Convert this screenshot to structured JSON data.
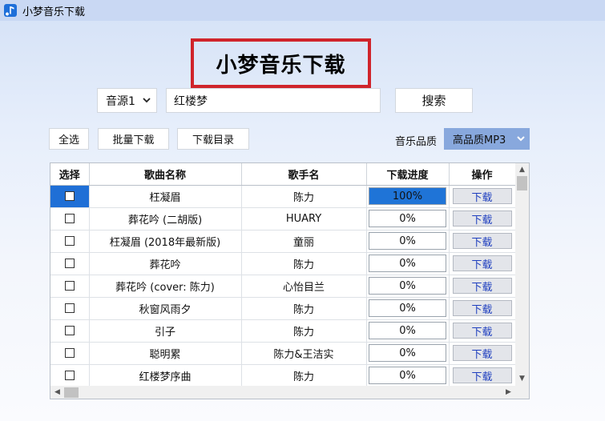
{
  "window": {
    "title": "小梦音乐下载",
    "icon": "music-note-icon"
  },
  "header": {
    "headline": "小梦音乐下载"
  },
  "search": {
    "source_selected": "音源1",
    "query": "红楼梦",
    "button_label": "搜索"
  },
  "toolbar": {
    "select_all_label": "全选",
    "batch_download_label": "批量下载",
    "download_dir_label": "下载目录",
    "quality_label": "音乐品质",
    "quality_selected": "高品质MP3"
  },
  "table": {
    "columns": [
      "选择",
      "歌曲名称",
      "歌手名",
      "下载进度",
      "操作"
    ],
    "rows": [
      {
        "song": "枉凝眉",
        "artist": "陈力",
        "progress": "100%",
        "progress_value": 1.0,
        "action": "下载"
      },
      {
        "song": "葬花吟 (二胡版)",
        "artist": "HUARY",
        "progress": "0%",
        "progress_value": 0,
        "action": "下载"
      },
      {
        "song": "枉凝眉 (2018年最新版)",
        "artist": "童丽",
        "progress": "0%",
        "progress_value": 0,
        "action": "下载"
      },
      {
        "song": "葬花吟",
        "artist": "陈力",
        "progress": "0%",
        "progress_value": 0,
        "action": "下载"
      },
      {
        "song": "葬花吟 (cover: 陈力)",
        "artist": "心怡目兰",
        "progress": "0%",
        "progress_value": 0,
        "action": "下载"
      },
      {
        "song": "秋窗风雨夕",
        "artist": "陈力",
        "progress": "0%",
        "progress_value": 0,
        "action": "下载"
      },
      {
        "song": "引子",
        "artist": "陈力",
        "progress": "0%",
        "progress_value": 0,
        "action": "下载"
      },
      {
        "song": "聪明累",
        "artist": "陈力&王洁实",
        "progress": "0%",
        "progress_value": 0,
        "action": "下载"
      },
      {
        "song": "红楼梦序曲",
        "artist": "陈力",
        "progress": "0%",
        "progress_value": 0,
        "action": "下载"
      }
    ]
  },
  "colors": {
    "headline_border": "#d0242b",
    "progress_fill": "#1f74d7",
    "selected_cell": "#1f6fd6",
    "download_text": "#1f3fbf",
    "quality_select_bg": "#88a8dd"
  }
}
